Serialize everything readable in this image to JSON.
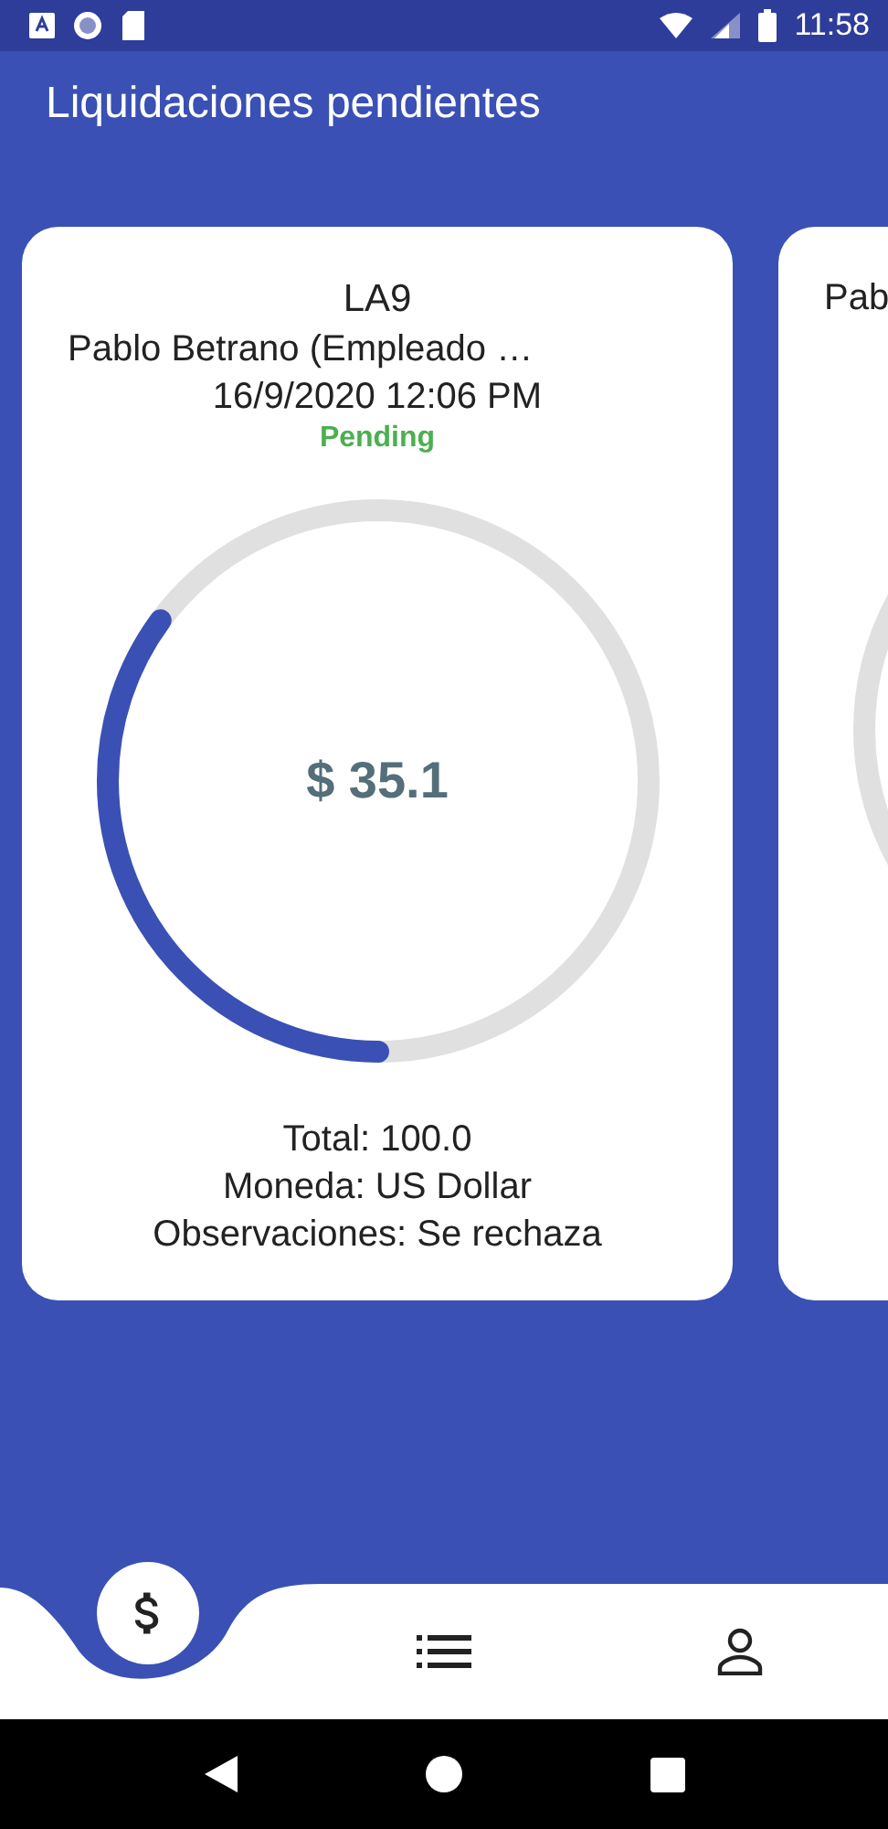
{
  "status_bar": {
    "time": "11:58"
  },
  "title": "Liquidaciones pendientes",
  "cards": [
    {
      "code": "LA9",
      "name": "Pablo Betrano (Empleado …",
      "date": "16/9/2020 12:06 PM",
      "status": "Pending",
      "amount": "$ 35.1",
      "level": 0.351,
      "total": "Total: 100.0",
      "currency": "Moneda: US Dollar",
      "notes": "Observaciones: Se rechaza"
    },
    {
      "name": "Pab"
    }
  ],
  "nav": [
    {
      "kind": "dollar",
      "selected": true
    },
    {
      "kind": "list",
      "selected": false
    },
    {
      "kind": "person",
      "selected": false
    }
  ]
}
